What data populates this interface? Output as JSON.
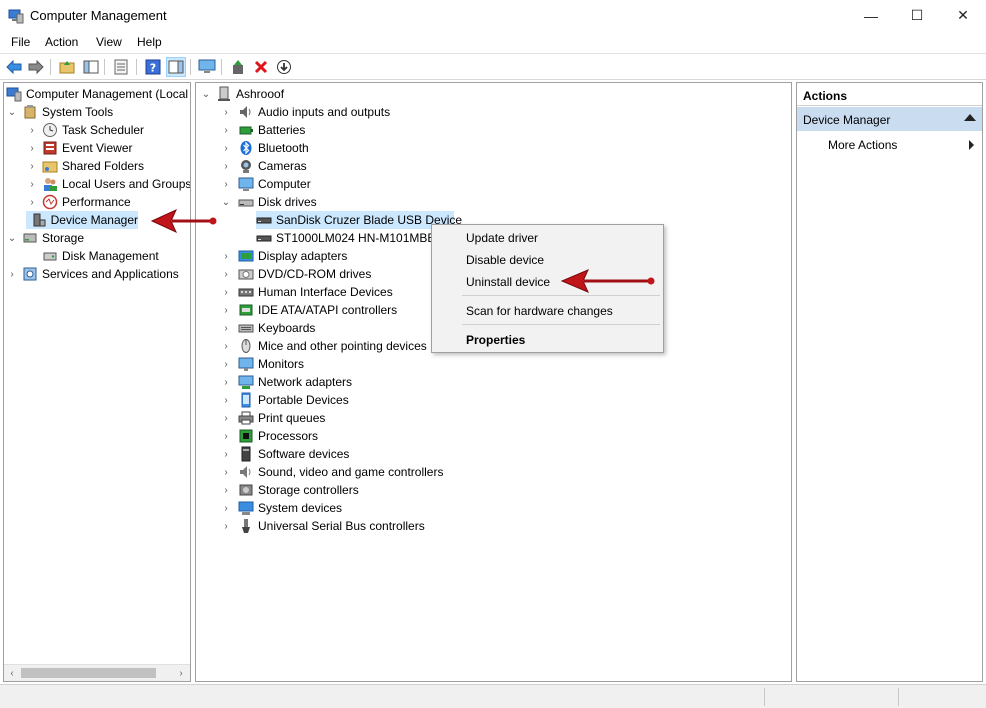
{
  "window": {
    "title": "Computer Management",
    "minimize_glyph": "—",
    "maximize_glyph": "☐",
    "close_glyph": "✕"
  },
  "menu": [
    "File",
    "Action",
    "View",
    "Help"
  ],
  "left_tree": {
    "root": "Computer Management (Local",
    "items": [
      {
        "label": "System Tools",
        "icon": "tools-icon",
        "level": 1,
        "expanded": true
      },
      {
        "label": "Task Scheduler",
        "icon": "clock-icon",
        "level": 2,
        "expanded": false
      },
      {
        "label": "Event Viewer",
        "icon": "event-viewer-icon",
        "level": 2,
        "expanded": false
      },
      {
        "label": "Shared Folders",
        "icon": "shared-folder-icon",
        "level": 2,
        "expanded": false
      },
      {
        "label": "Local Users and Groups",
        "icon": "users-icon",
        "level": 2,
        "expanded": false
      },
      {
        "label": "Performance",
        "icon": "performance-icon",
        "level": 2,
        "expanded": false
      },
      {
        "label": "Device Manager",
        "icon": "device-manager-icon",
        "level": 2,
        "selected": true
      },
      {
        "label": "Storage",
        "icon": "storage-icon",
        "level": 1,
        "expanded": true
      },
      {
        "label": "Disk Management",
        "icon": "disk-management-icon",
        "level": 2
      },
      {
        "label": "Services and Applications",
        "icon": "services-icon",
        "level": 1,
        "expanded": false
      }
    ]
  },
  "device_tree": {
    "computer_name": "Ashrooof",
    "categories": [
      {
        "label": "Audio inputs and outputs",
        "icon": "speaker-icon"
      },
      {
        "label": "Batteries",
        "icon": "battery-icon"
      },
      {
        "label": "Bluetooth",
        "icon": "bluetooth-icon"
      },
      {
        "label": "Cameras",
        "icon": "camera-icon"
      },
      {
        "label": "Computer",
        "icon": "computer-icon"
      },
      {
        "label": "Disk drives",
        "icon": "disk-drive-icon",
        "expanded": true,
        "children": [
          "SanDisk Cruzer Blade USB Device",
          "ST1000LM024 HN-M101MBB"
        ]
      },
      {
        "label": "Display adapters",
        "icon": "display-adapter-icon"
      },
      {
        "label": "DVD/CD-ROM drives",
        "icon": "dvd-icon"
      },
      {
        "label": "Human Interface Devices",
        "icon": "hid-icon"
      },
      {
        "label": "IDE ATA/ATAPI controllers",
        "icon": "ide-icon"
      },
      {
        "label": "Keyboards",
        "icon": "keyboard-icon"
      },
      {
        "label": "Mice and other pointing devices",
        "icon": "mouse-icon"
      },
      {
        "label": "Monitors",
        "icon": "monitor-icon"
      },
      {
        "label": "Network adapters",
        "icon": "network-icon"
      },
      {
        "label": "Portable Devices",
        "icon": "portable-device-icon"
      },
      {
        "label": "Print queues",
        "icon": "printer-icon"
      },
      {
        "label": "Processors",
        "icon": "processor-icon"
      },
      {
        "label": "Software devices",
        "icon": "software-device-icon"
      },
      {
        "label": "Sound, video and game controllers",
        "icon": "sound-icon"
      },
      {
        "label": "Storage controllers",
        "icon": "storage-controller-icon"
      },
      {
        "label": "System devices",
        "icon": "system-device-icon"
      },
      {
        "label": "Universal Serial Bus controllers",
        "icon": "usb-icon"
      }
    ]
  },
  "context_menu": {
    "items": [
      "Update driver",
      "Disable device",
      "Uninstall device",
      "Scan for hardware changes",
      "Properties"
    ]
  },
  "actions": {
    "header": "Actions",
    "section": "Device Manager",
    "more": "More Actions"
  },
  "colors": {
    "selection": "#cce8ff",
    "actions_section": "#c9dcf0",
    "annotation_arrow": "#c0151a"
  }
}
